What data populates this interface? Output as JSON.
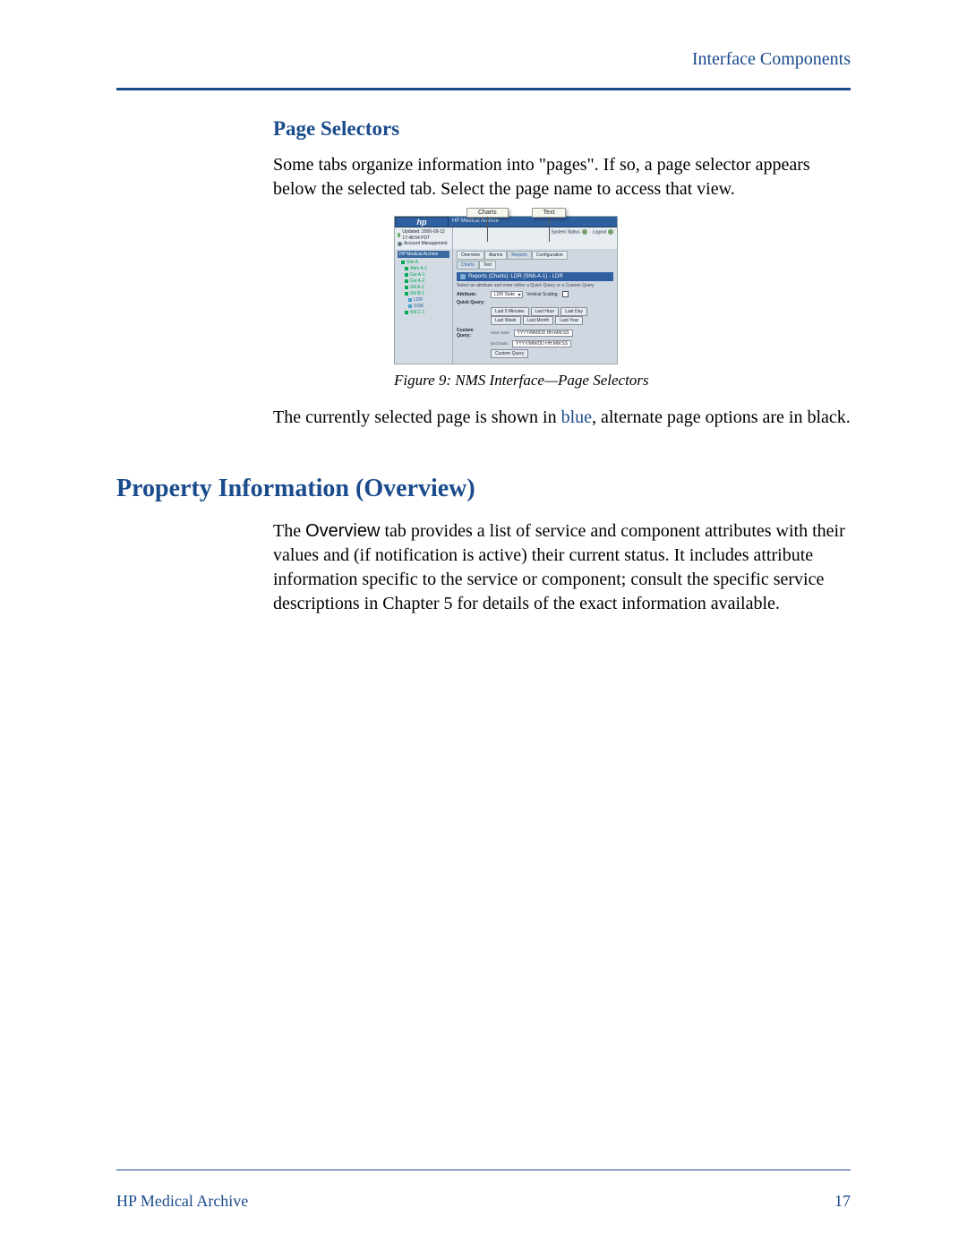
{
  "header": {
    "section_title": "Interface Components"
  },
  "section1": {
    "heading": "Page Selectors",
    "p1": "Some tabs organize information into \"pages\". If so, a page selector appears below the selected tab. Select the page name to access that view."
  },
  "figure": {
    "caption": "Figure 9: NMS Interface—Page Selectors",
    "callouts": {
      "charts": "Charts",
      "text": "Text"
    },
    "logo": "hp",
    "title": "HP Medical Archive",
    "info_left": {
      "line1": "Updated: 2006-09-13  17:48:54 PDT",
      "line2": "Account Management"
    },
    "info_right": {
      "a": "System Status",
      "b": "Logout"
    },
    "tree_header": "HP Medical Archive",
    "tree_items": [
      "Site A",
      "Adm A-1",
      "Gw A-1",
      "Gw A-2",
      "SN A-1",
      "SN B-1",
      "LDR",
      "SSM",
      "SN C-1"
    ],
    "tabs": [
      "Overview",
      "Alarms",
      "Reports",
      "Configuration"
    ],
    "subtabs": [
      "Charts",
      "Text"
    ],
    "panel_title": "Reports (Charts): LDR (SN8-A-1) - LDR",
    "hint": "Select an attribute and enter either a Quick Query or a Custom Query",
    "rows": {
      "attribute_label": "Attribute:",
      "attribute_value": "LDR State",
      "vscale_label": "Vertical Scaling:",
      "quick_label": "Quick Query:",
      "quick_buttons": [
        "Last 5 Minutes",
        "Last Hour",
        "Last Day",
        "Last Week",
        "Last Month",
        "Last Year"
      ],
      "custom_label": "Custom Query:",
      "start_label": "Start Date:",
      "start_value": "YYYY/MM/DD HH:MM:SS",
      "end_label": "End Date:",
      "end_value": "YYYY/MM/DD HH:MM:SS",
      "custom_btn": "Custom Query"
    }
  },
  "section1b": {
    "p2a": "The currently selected page is shown in ",
    "p2_blue": "blue",
    "p2b": ", alternate page options are in black."
  },
  "section2": {
    "heading": "Property Information (Overview)",
    "p_a": "The ",
    "p_ov": "Overview",
    "p_b": " tab provides a list of service and component attributes with their values and (if notification is active) their current status. It includes attribute information specific to the service or component; consult the specific service descriptions in Chapter 5 for details of the exact information available."
  },
  "footer": {
    "left": "HP Medical Archive",
    "page": "17"
  }
}
